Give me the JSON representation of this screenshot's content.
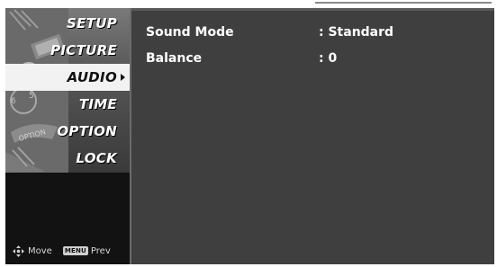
{
  "menu": {
    "items": [
      {
        "label": "SETUP",
        "active": false
      },
      {
        "label": "PICTURE",
        "active": false
      },
      {
        "label": "AUDIO",
        "active": true
      },
      {
        "label": "TIME",
        "active": false
      },
      {
        "label": "OPTION",
        "active": false
      },
      {
        "label": "LOCK",
        "active": false
      }
    ]
  },
  "footer": {
    "move_label": "Move",
    "menu_key_label": "MENU",
    "prev_label": "Prev"
  },
  "settings": [
    {
      "label": "Sound Mode",
      "value": ": Standard"
    },
    {
      "label": "Balance",
      "value": ": 0"
    }
  ],
  "colors": {
    "panel_bg": "#3f3f3f",
    "sidebar_bg": "#121212",
    "active_bg": "#f2f2f2"
  }
}
